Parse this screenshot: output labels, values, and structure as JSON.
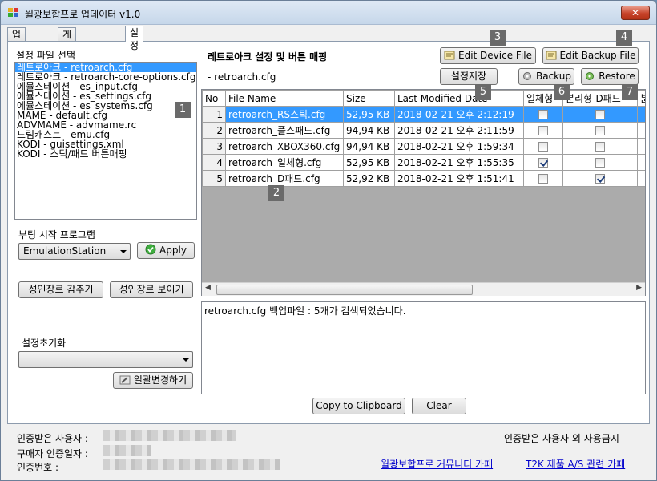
{
  "window": {
    "title": "월광보합프로 업데이터 v1.0",
    "close_label": "✕"
  },
  "tabs": [
    {
      "label": "업데이트"
    },
    {
      "label": "게임목록관리"
    },
    {
      "label": "설정"
    }
  ],
  "left": {
    "list_title": "설정 파일 선택",
    "items": [
      "레트로아크 - retroarch.cfg",
      "레트로아크 - retroarch-core-options.cfg",
      "에뮬스테이션 - es_input.cfg",
      "에뮬스테이션 - es_settings.cfg",
      "에뮬스테이션 - es_systems.cfg",
      "MAME - default.cfg",
      "ADVMAME - advmame.rc",
      "드림캐스트 - emu.cfg",
      "KODI - guisettings.xml",
      "KODI - 스틱/패드 버튼매핑"
    ],
    "boot_label": "부팅 시작 프로그램",
    "boot_value": "EmulationStation",
    "apply_label": "Apply",
    "hide_adult_label": "성인장르 감추기",
    "show_adult_label": "성인장르 보이기",
    "reset_label": "설정초기화",
    "reset_value": "",
    "batch_label": "일괄변경하기"
  },
  "right": {
    "section_title": "레트로아크 설정 및 버튼 매핑",
    "current_file": "-   retroarch.cfg",
    "edit_device_label": "Edit Device File",
    "edit_backup_label": "Edit Backup File",
    "save_label": "설정저장",
    "backup_label": "Backup",
    "restore_label": "Restore",
    "columns": [
      "No",
      "File Name",
      "Size",
      "Last Modified Date",
      "일체형",
      "분리형-D패드",
      "분"
    ],
    "rows": [
      {
        "no": "1",
        "name": "retroarch_RS스틱.cfg",
        "size": "52,95 KB",
        "date": "2018-02-21 오후 2:12:19",
        "c1": false,
        "c2": false
      },
      {
        "no": "2",
        "name": "retroarch_플스패드.cfg",
        "size": "94,94 KB",
        "date": "2018-02-21 오후 2:11:59",
        "c1": false,
        "c2": false
      },
      {
        "no": "3",
        "name": "retroarch_XBOX360.cfg",
        "size": "94,94 KB",
        "date": "2018-02-21 오후 1:59:34",
        "c1": false,
        "c2": false
      },
      {
        "no": "4",
        "name": "retroarch_일체형.cfg",
        "size": "52,95 KB",
        "date": "2018-02-21 오후 1:55:35",
        "c1": true,
        "c2": false
      },
      {
        "no": "5",
        "name": "retroarch_D패드.cfg",
        "size": "52,92 KB",
        "date": "2018-02-21 오후 1:51:41",
        "c1": false,
        "c2": true
      }
    ],
    "log_text": "retroarch.cfg 백업파일 : 5개가 검색되었습니다.",
    "copy_label": "Copy to Clipboard",
    "clear_label": "Clear"
  },
  "badges": [
    "1",
    "2",
    "3",
    "4",
    "5",
    "6",
    "7"
  ],
  "footer": {
    "user_label": "인증받은 사용자 :",
    "date_label": "구매자 인증일자 :",
    "code_label": "인증번호 :",
    "notice": "인증받은 사용자 외 사용금지",
    "link_community": "월광보합프로 커뮤니티 카페",
    "link_as": "T2K 제품 A/S 관련 카페"
  },
  "colors": {
    "selection": "#3399ff",
    "link": "#0000cc",
    "badge": "#6a6a6a"
  }
}
